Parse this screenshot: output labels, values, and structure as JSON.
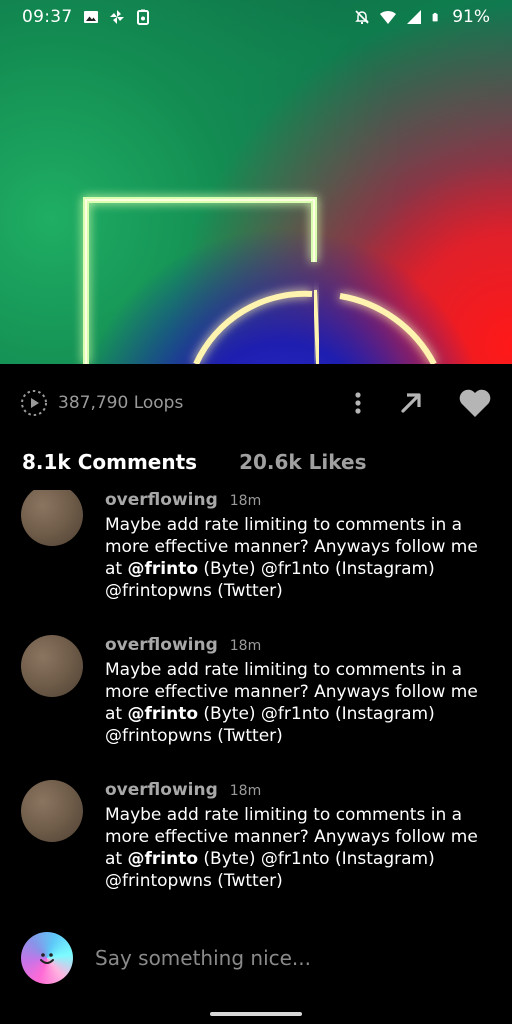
{
  "status_bar": {
    "time": "09:37",
    "battery": "91%",
    "icons": [
      "image-icon",
      "pinwheel-icon",
      "battery-app-icon",
      "mute-icon",
      "wifi-icon",
      "signal-icon",
      "battery-icon"
    ]
  },
  "video": {
    "colors": {
      "green": "#0f7c4d",
      "blue": "#2424c8",
      "red": "#ff1818",
      "neon": "#fff6c0"
    }
  },
  "meta": {
    "loops": "387,790 Loops"
  },
  "tabs": [
    {
      "label": "8.1k Comments",
      "active": true
    },
    {
      "label": "20.6k Likes",
      "active": false
    }
  ],
  "comments": [
    {
      "username": "overflowing",
      "time": "18m",
      "text_before": "Maybe add rate limiting to comments in a more effective manner? Anyways follow me at ",
      "mention": "@frinto",
      "text_after": " (Byte) @fr1nto (Instagram) @frintopwns (Twtter)"
    },
    {
      "username": "overflowing",
      "time": "18m",
      "text_before": "Maybe add rate limiting to comments in a more effective manner? Anyways follow me at ",
      "mention": "@frinto",
      "text_after": " (Byte) @fr1nto (Instagram) @frintopwns (Twtter)"
    },
    {
      "username": "overflowing",
      "time": "18m",
      "text_before": "Maybe add rate limiting to comments in a more effective manner? Anyways follow me at ",
      "mention": "@frinto",
      "text_after": " (Byte) @fr1nto (Instagram) @frintopwns (Twtter)"
    }
  ],
  "composer": {
    "placeholder": "Say something nice..."
  }
}
